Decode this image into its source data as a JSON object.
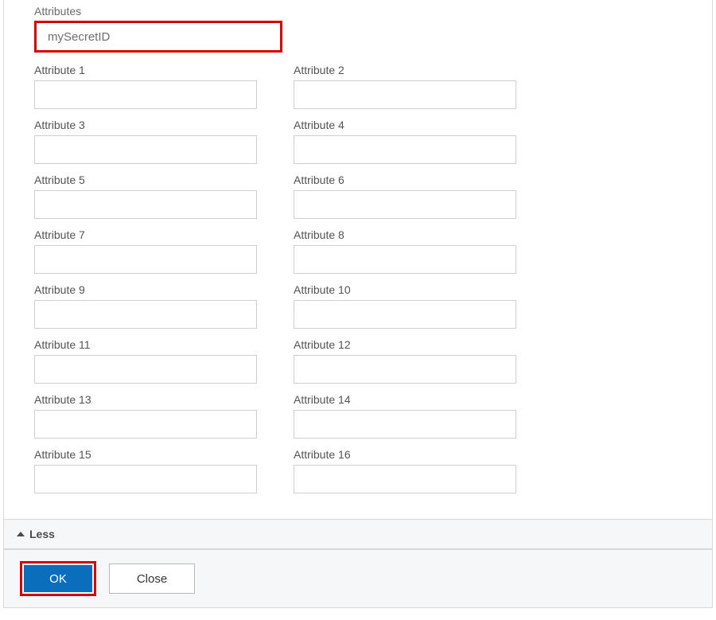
{
  "section": {
    "title": "Attributes",
    "secret_id": "mySecretID"
  },
  "attributes": [
    {
      "label": "Attribute 1",
      "value": ""
    },
    {
      "label": "Attribute 2",
      "value": ""
    },
    {
      "label": "Attribute 3",
      "value": ""
    },
    {
      "label": "Attribute 4",
      "value": ""
    },
    {
      "label": "Attribute 5",
      "value": ""
    },
    {
      "label": "Attribute 6",
      "value": ""
    },
    {
      "label": "Attribute 7",
      "value": ""
    },
    {
      "label": "Attribute 8",
      "value": ""
    },
    {
      "label": "Attribute 9",
      "value": ""
    },
    {
      "label": "Attribute 10",
      "value": ""
    },
    {
      "label": "Attribute 11",
      "value": ""
    },
    {
      "label": "Attribute 12",
      "value": ""
    },
    {
      "label": "Attribute 13",
      "value": ""
    },
    {
      "label": "Attribute 14",
      "value": ""
    },
    {
      "label": "Attribute 15",
      "value": ""
    },
    {
      "label": "Attribute 16",
      "value": ""
    }
  ],
  "collapse": {
    "label": "Less"
  },
  "footer": {
    "ok_label": "OK",
    "close_label": "Close"
  }
}
